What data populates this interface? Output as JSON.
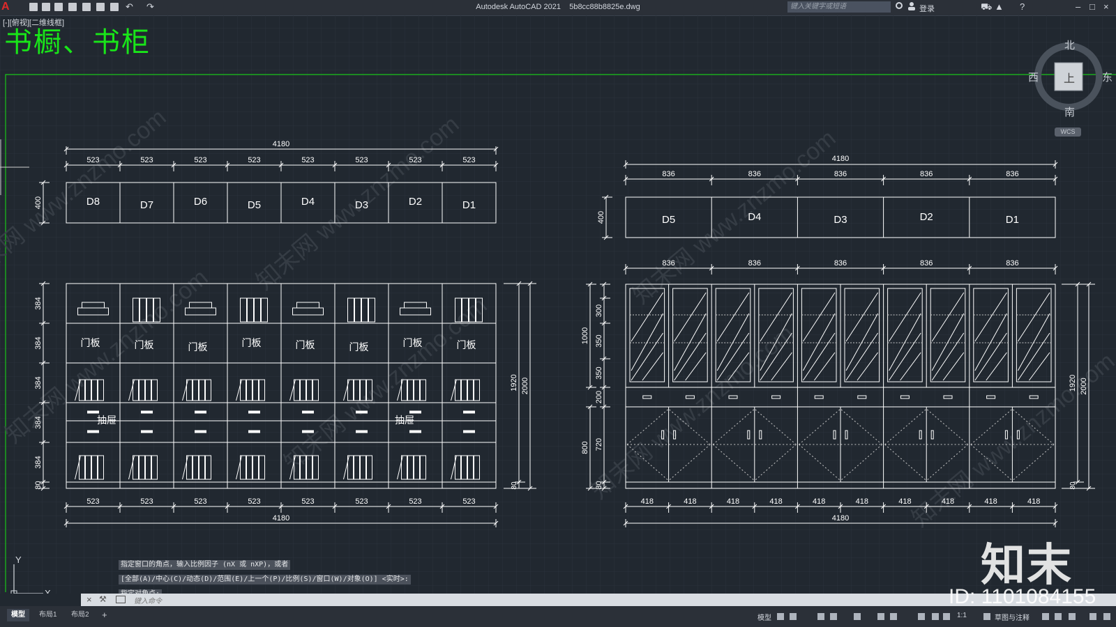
{
  "titlebar": {
    "app_title": "Autodesk AutoCAD 2021",
    "file_name": "5b8cc88b8825e.dwg",
    "search_placeholder": "键入关键字或短语",
    "login_label": "登录"
  },
  "viewport_label": "[-][俯视][二维线框]",
  "drawing_title": "书橱、书柜",
  "viewcube": {
    "north": "北",
    "south": "南",
    "west": "西",
    "east": "东",
    "face": "上",
    "wcs": "WCS"
  },
  "left_elevation": {
    "total_width": "4180",
    "module_width": "523",
    "modules_count": 8,
    "top_unit_height": "400",
    "top_labels": [
      "D8",
      "D7",
      "D6",
      "D5",
      "D4",
      "D3",
      "D2",
      "D1"
    ],
    "row_heights": [
      "384",
      "384",
      "384",
      "384",
      "384",
      "80"
    ],
    "door_label": "门板",
    "drawer_label": "抽屉",
    "inner_height": "1920",
    "total_height": "2000",
    "base": "80"
  },
  "right_elevation": {
    "total_width": "4180",
    "module_width": "836",
    "door_width": "418",
    "doors_count": 10,
    "top_unit_height": "400",
    "top_labels": [
      "D5",
      "D4",
      "D3",
      "D2",
      "D1"
    ],
    "row_heights": [
      "300",
      "350",
      "350",
      "200",
      "720",
      "80"
    ],
    "upper_height": "1000",
    "lower_height": "800",
    "inner_height": "1920",
    "total_height": "2000"
  },
  "command_history": [
    "指定窗口的角点，输入比例因子 (nX 或 nXP)，或者",
    "[全部(A)/中心(C)/动态(D)/范围(E)/上一个(P)/比例(S)/窗口(W)/对象(O)] <实时>:",
    "指定对角点:"
  ],
  "command_input_placeholder": "键入命令",
  "layout_tabs": [
    "模型",
    "布局1",
    "布局2",
    "+"
  ],
  "statusbar": {
    "model": "模型",
    "scale": "1:1",
    "workspace": "草图与注释"
  },
  "ucs": {
    "x": "X",
    "y": "Y"
  },
  "brand": {
    "logo": "知末",
    "id": "ID: 1101084155"
  },
  "watermark": "知末网 www.znzmo.com",
  "colors": {
    "background": "#212830",
    "title_green": "#19e619",
    "lines": "#ffffff",
    "dashed": "#c8c8c8"
  }
}
